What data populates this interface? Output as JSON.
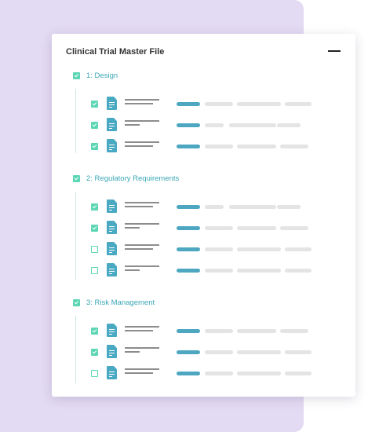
{
  "card": {
    "title": "Clinical Trial Master File"
  },
  "colors": {
    "accent_teal": "#3aa7b6",
    "checkbox_green": "#5cd6b4",
    "doc_icon": "#4aa9c2",
    "background_lilac": "#e3daf3"
  },
  "icons": [
    "minus-icon",
    "checkbox-icon",
    "document-icon"
  ],
  "sections": [
    {
      "label": "1: Design",
      "checked": true,
      "rows": [
        {
          "checked": true
        },
        {
          "checked": true
        },
        {
          "checked": true
        }
      ]
    },
    {
      "label": "2: Regulatory Requirements",
      "checked": true,
      "rows": [
        {
          "checked": true
        },
        {
          "checked": true
        },
        {
          "checked": false
        },
        {
          "checked": false
        }
      ]
    },
    {
      "label": "3: Risk Management",
      "checked": true,
      "rows": [
        {
          "checked": true
        },
        {
          "checked": true
        },
        {
          "checked": false
        }
      ]
    }
  ]
}
